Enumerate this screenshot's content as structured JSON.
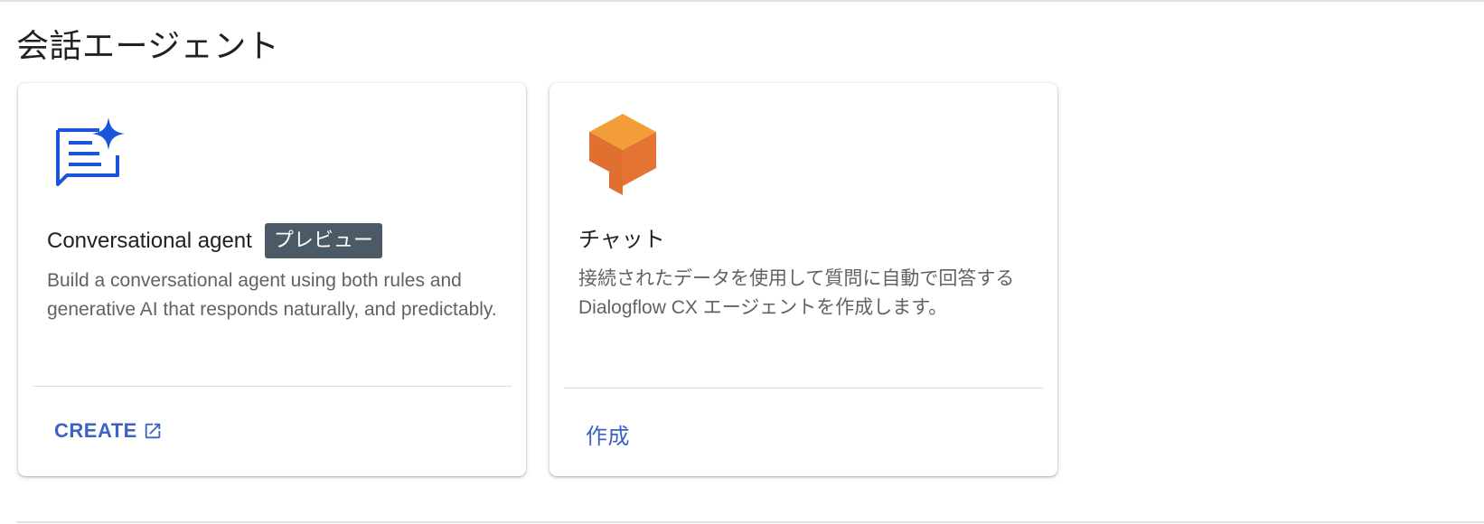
{
  "section": {
    "title": "会話エージェント"
  },
  "cards": [
    {
      "icon": "chat-sparkle-icon",
      "title": "Conversational agent",
      "badge": "プレビュー",
      "description": "Build a conversational agent using both rules and generative AI that responds naturally, and predictably.",
      "action_label": "CREATE",
      "action_icon": "open-in-new-icon"
    },
    {
      "icon": "dialogflow-cube-icon",
      "title": "チャット",
      "description": "接続されたデータを使用して質問に自動で回答する Dialogflow CX エージェントを作成します。",
      "action_label": "作成"
    }
  ],
  "colors": {
    "accent": "#3b62c4",
    "badge_bg": "#4b5a66",
    "icon_blue": "#1a56db",
    "cube_light": "#f29d38",
    "cube_dark": "#e07030"
  }
}
